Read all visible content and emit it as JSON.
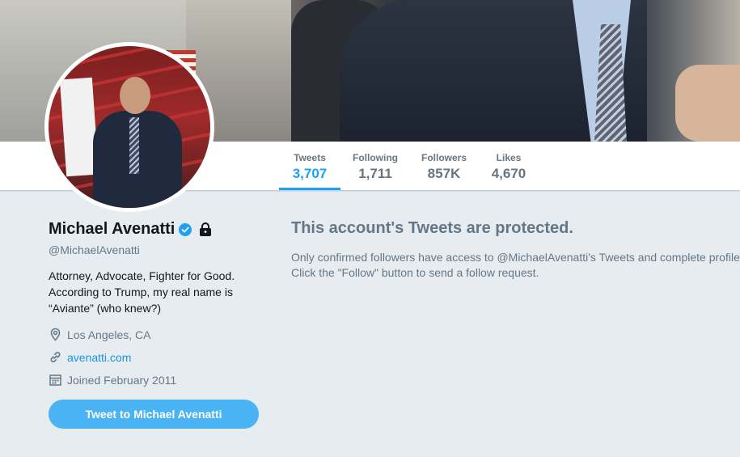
{
  "profile": {
    "name": "Michael Avenatti",
    "handle": "@MichaelAvenatti",
    "bio": [
      "Attorney, Advocate, Fighter for Good.",
      "According to Trump, my real name is",
      "“Aviante” (who knew?)"
    ],
    "location": "Los Angeles, CA",
    "website": "avenatti.com",
    "joined": "Joined February 2011",
    "verified": true,
    "protected": true,
    "tweet_to_label": "Tweet to Michael Avenatti"
  },
  "stats": [
    {
      "label": "Tweets",
      "value": "3,707",
      "active": true
    },
    {
      "label": "Following",
      "value": "1,711",
      "active": false
    },
    {
      "label": "Followers",
      "value": "857K",
      "active": false
    },
    {
      "label": "Likes",
      "value": "4,670",
      "active": false
    }
  ],
  "protected_notice": {
    "title": "This account's Tweets are protected.",
    "body": [
      "Only confirmed followers have access to @MichaelAvenatti's Tweets and complete profile.",
      "Click the \"Follow\" button to send a follow request."
    ]
  },
  "icons": {
    "verified": "verified-badge-icon",
    "lock": "lock-icon",
    "location": "location-pin-icon",
    "link": "link-icon",
    "calendar": "calendar-icon"
  },
  "colors": {
    "accent": "#1da1f2",
    "background": "#e6ecf0",
    "muted_text": "#657786",
    "button": "#4ab3f4"
  }
}
